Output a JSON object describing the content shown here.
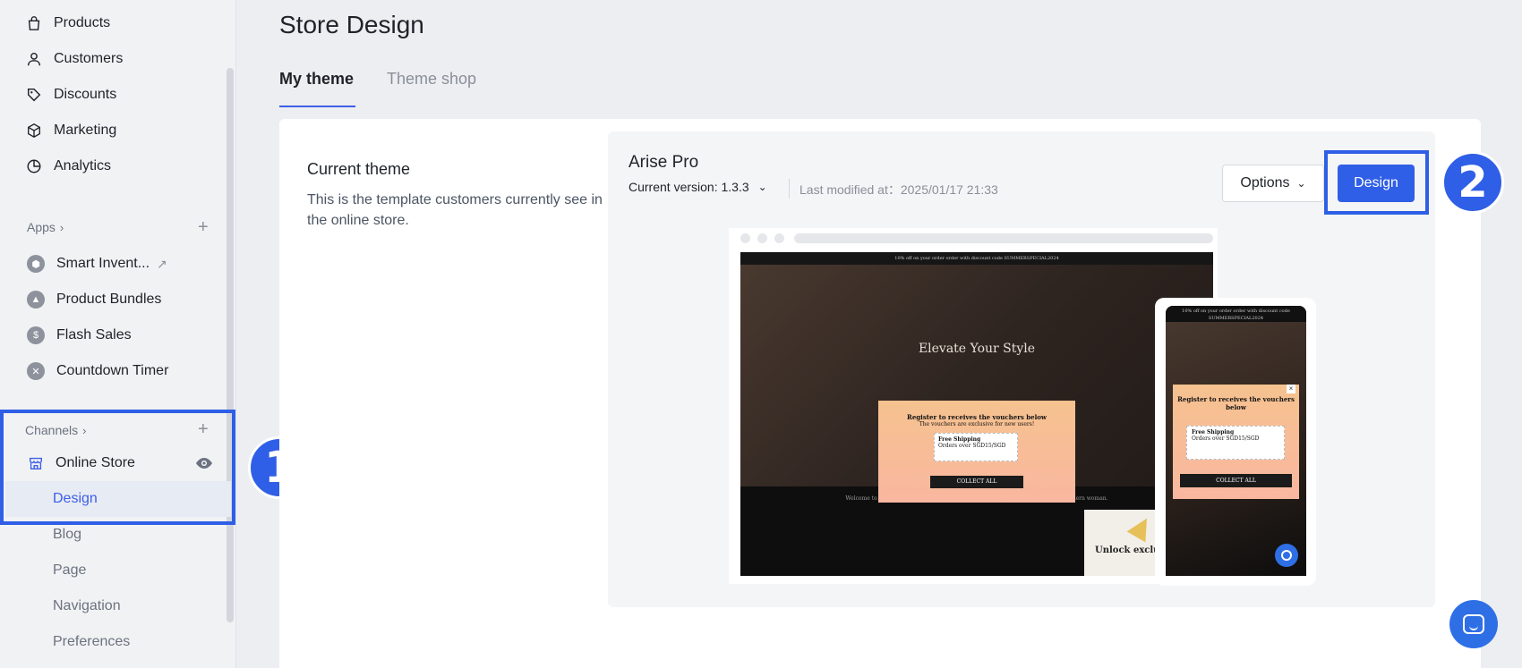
{
  "sidebar": {
    "items": [
      {
        "label": "Products",
        "icon": "bag-icon"
      },
      {
        "label": "Customers",
        "icon": "person-icon"
      },
      {
        "label": "Discounts",
        "icon": "tag-icon"
      },
      {
        "label": "Marketing",
        "icon": "cube-icon"
      },
      {
        "label": "Analytics",
        "icon": "pie-chart-icon"
      }
    ],
    "apps_label": "Apps",
    "apps": [
      {
        "label": "Smart Invent...",
        "icon": "smart-inventory-icon"
      },
      {
        "label": "Product Bundles",
        "icon": "product-bundles-icon"
      },
      {
        "label": "Flash Sales",
        "icon": "flash-sales-icon"
      },
      {
        "label": "Countdown Timer",
        "icon": "countdown-timer-icon"
      }
    ],
    "channels_label": "Channels",
    "online_store": "Online Store",
    "subitems": [
      "Design",
      "Blog",
      "Page",
      "Navigation",
      "Preferences"
    ]
  },
  "annotations": {
    "badge1": "1",
    "badge2": "2"
  },
  "main": {
    "title": "Store Design",
    "tabs": [
      "My theme",
      "Theme shop"
    ],
    "current_theme_title": "Current theme",
    "current_theme_desc": "This is the template customers currently see in the online store.",
    "theme_name": "Arise Pro",
    "version": "Current version: 1.3.3",
    "last_modified": "Last modified at：2025/01/17 21:33",
    "options_label": "Options",
    "design_label": "Design"
  },
  "preview": {
    "topbar": "10% off on your order order with discount code SUMMERSPECIAL2024",
    "hero": "Elevate Your Style",
    "popup_title": "Register to receives the vouchers below",
    "popup_sub": "The vouchers are exclusive for new users!",
    "voucher_title": "Free Shipping",
    "voucher_desc": "Orders over SGD15/SGD",
    "collect": "COLLECT ALL",
    "band_text": "Welcome to Bumble Bumble, where elegance and fashion unite to empower the modern woman.",
    "unlock": "Unlock exclusive",
    "mobile_popup_title": "Register to receives the vouchers below",
    "mobile_voucher_title": "Free Shipping",
    "mobile_voucher_desc": "Orders over SGD15/SGD",
    "mobile_collect": "COLLECT ALL"
  },
  "colors": {
    "accent": "#2f5fe6",
    "sidebar_bg": "#f1f2f4",
    "page_bg": "#eceef2"
  }
}
